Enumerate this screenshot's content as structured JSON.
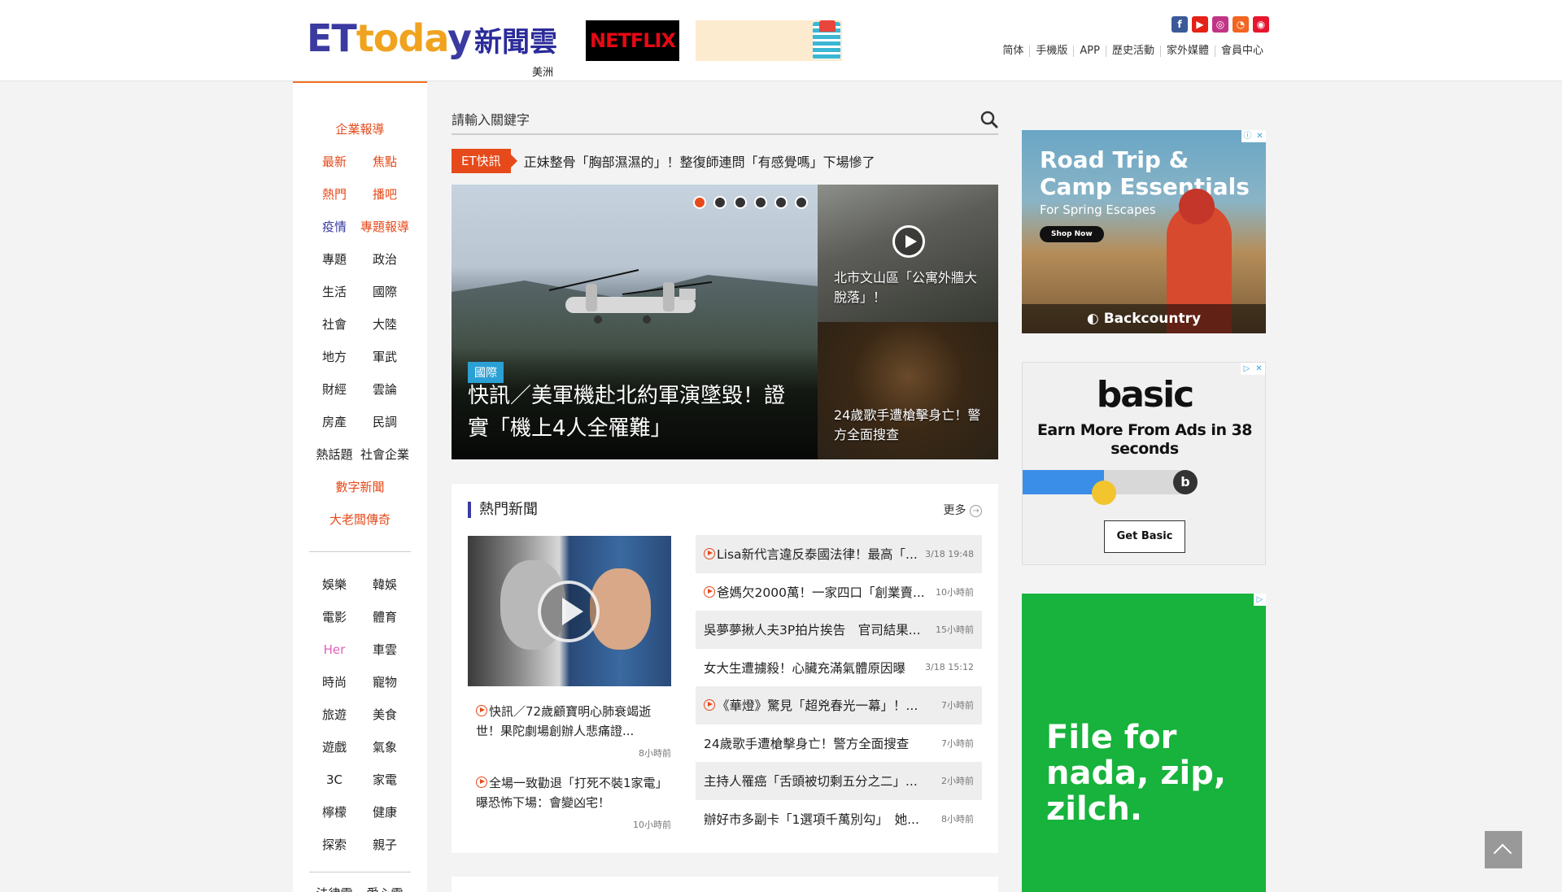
{
  "header": {
    "logo_latin": [
      "ET",
      "toda",
      "y"
    ],
    "logo_zh": "新聞雲",
    "region": "美洲",
    "netflix_ad": "NETFLIX",
    "social_icons": [
      "facebook-icon",
      "youtube-icon",
      "instagram-icon",
      "rss-icon",
      "weibo-icon"
    ],
    "top_links": [
      "简体",
      "手機版",
      "APP",
      "歷史活動",
      "家外媒體",
      "會員中心"
    ]
  },
  "sidebar": {
    "items": [
      {
        "label": "企業報導",
        "color": "#e64a1a"
      },
      {
        "label": "最新",
        "color": "#e64a1a"
      },
      {
        "label": "焦點",
        "color": "#e64a1a"
      },
      {
        "label": "熱門",
        "color": "#e64a1a"
      },
      {
        "label": "播吧",
        "color": "#e64a1a"
      },
      {
        "label": "疫情",
        "color": "#3a3aa0"
      },
      {
        "label": "專題報導",
        "color": "#e64a1a"
      },
      {
        "label": "專題",
        "color": "#222222"
      },
      {
        "label": "政治",
        "color": "#222222"
      },
      {
        "label": "生活",
        "color": "#222222"
      },
      {
        "label": "國際",
        "color": "#222222"
      },
      {
        "label": "社會",
        "color": "#222222"
      },
      {
        "label": "大陸",
        "color": "#222222"
      },
      {
        "label": "地方",
        "color": "#222222"
      },
      {
        "label": "軍武",
        "color": "#222222"
      },
      {
        "label": "財經",
        "color": "#222222"
      },
      {
        "label": "雲論",
        "color": "#222222"
      },
      {
        "label": "房產",
        "color": "#222222"
      },
      {
        "label": "民調",
        "color": "#222222"
      },
      {
        "label": "熱話題",
        "color": "#222222"
      },
      {
        "label": "社會企業",
        "color": "#222222"
      },
      {
        "label": "數字新聞",
        "color": "#e64a1a"
      },
      {
        "label": "大老闆傳奇",
        "color": "#e64a1a"
      },
      {
        "label": "娛樂",
        "color": "#222222"
      },
      {
        "label": "韓娛",
        "color": "#222222"
      },
      {
        "label": "電影",
        "color": "#222222"
      },
      {
        "label": "體育",
        "color": "#222222"
      },
      {
        "label": "Her",
        "color": "#e060b8"
      },
      {
        "label": "車雲",
        "color": "#222222"
      },
      {
        "label": "時尚",
        "color": "#222222"
      },
      {
        "label": "寵物",
        "color": "#222222"
      },
      {
        "label": "旅遊",
        "color": "#222222"
      },
      {
        "label": "美食",
        "color": "#222222"
      },
      {
        "label": "遊戲",
        "color": "#222222"
      },
      {
        "label": "氣象",
        "color": "#222222"
      },
      {
        "label": "3C",
        "color": "#222222"
      },
      {
        "label": "家電",
        "color": "#222222"
      },
      {
        "label": "檸檬",
        "color": "#222222"
      },
      {
        "label": "健康",
        "color": "#222222"
      },
      {
        "label": "探索",
        "color": "#222222"
      },
      {
        "label": "親子",
        "color": "#222222"
      },
      {
        "label": "法律雲",
        "color": "#222222"
      },
      {
        "label": "愛心雲",
        "color": "#222222"
      }
    ]
  },
  "search": {
    "placeholder": "請輸入關鍵字"
  },
  "flash": {
    "badge": "ET快訊",
    "text": "正妹整骨「胸部濕濕的」！整復師連問「有感覺嗎」下場慘了"
  },
  "hero": {
    "tag": "國際",
    "title": "快訊／美軍機赴北約軍演墜毀！證實「機上4人全罹難」",
    "slide_count": 6,
    "active_slide": 0
  },
  "side_stories": [
    {
      "caption": "北市文山區「公寓外牆大脫落」！",
      "video": true
    },
    {
      "caption": "24歲歌手遭槍擊身亡！警方全面搜查",
      "video": false
    }
  ],
  "hot_news": {
    "title": "熱門新聞",
    "more": "更多",
    "featured": [
      {
        "title": "快訊／72歲顧寶明心肺衰竭逝世！果陀劇場創辦人悲痛證...",
        "time": "8小時前",
        "video": true
      },
      {
        "title": "全場一致勸退「打死不裝1家電」　曝恐怖下場：會變凶宅！",
        "time": "10小時前",
        "video": true
      }
    ],
    "list": [
      {
        "title": "Lisa新代言違反泰國法律！最高「...",
        "time": "3/18 19:48",
        "video": true
      },
      {
        "title": "爸媽欠2000萬！一家四口「創業賣...",
        "time": "10小時前",
        "video": true
      },
      {
        "title": "吳夢夢揪人夫3P拍片挨告　官司結果...",
        "time": "15小時前",
        "video": false
      },
      {
        "title": "女大生遭擄殺！心臟充滿氣體原因曝",
        "time": "3/18 15:12",
        "video": false
      },
      {
        "title": "《華燈》驚見「超兇春光一幕」！...",
        "time": "7小時前",
        "video": true
      },
      {
        "title": "24歲歌手遭槍擊身亡！警方全面搜查",
        "time": "7小時前",
        "video": false
      },
      {
        "title": "主持人罹癌「舌頭被切剩五分之二」...",
        "time": "2小時前",
        "video": false
      },
      {
        "title": "辦好市多副卡「1選項千萬別勾」　她...",
        "time": "8小時前",
        "video": false
      }
    ]
  },
  "ads": {
    "backcountry": {
      "headline": "Road Trip & Camp Essentials",
      "sub": "For Spring Escapes",
      "cta": "Shop Now",
      "brand": "Backcountry"
    },
    "basic": {
      "logo": "basic",
      "text": "Earn More From Ads in 38 seconds",
      "cta": "Get Basic",
      "progress": 0.5
    },
    "green": {
      "headline": "File for nada, zip, zilch."
    }
  },
  "colors": {
    "accent": "#e64a1a",
    "brand": "#3a3aa0",
    "hero_tag": "#2aa0d4"
  }
}
